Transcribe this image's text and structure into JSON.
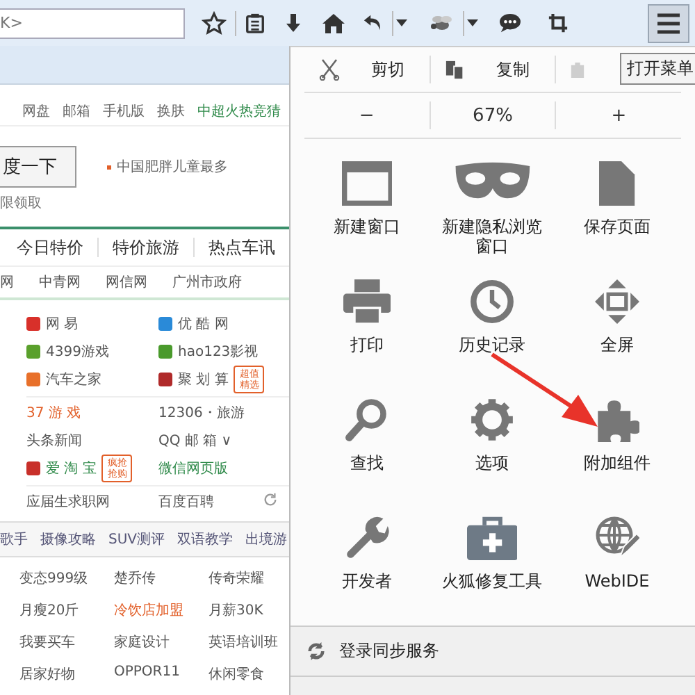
{
  "toolbar": {
    "url_fragment": "K>",
    "menu_open": true
  },
  "page": {
    "top_links": [
      {
        "label": "网盘",
        "color": "#666666"
      },
      {
        "label": "邮箱",
        "color": "#666666"
      },
      {
        "label": "手机版",
        "color": "#666666"
      },
      {
        "label": "换肤",
        "color": "#666666"
      },
      {
        "label": "中超火热竞猜",
        "color": "#2f8a4a"
      }
    ],
    "search_button": "度一下",
    "hot_search": "中国肥胖儿童最多",
    "hint": "限领取",
    "tabs": [
      "今日特价",
      "特价旅游",
      "热点车讯"
    ],
    "links": [
      "网",
      "中青网",
      "网信网",
      "广州市政府"
    ],
    "site_groups": [
      [
        {
          "label": "网 易",
          "kind": "logo",
          "color": "#555555"
        },
        {
          "label": "优 酷 网",
          "kind": "logo",
          "color": "#555555"
        },
        {
          "label": "4399游戏",
          "kind": "logo",
          "color": "#555555"
        },
        {
          "label": "hao123影视",
          "kind": "logo",
          "color": "#555555"
        },
        {
          "label": "汽车之家",
          "kind": "logo",
          "color": "#555555"
        },
        {
          "label": "聚 划 算",
          "kind": "logo",
          "color": "#555555",
          "badge": "超值精选"
        }
      ],
      [
        {
          "label": "37 游 戏",
          "kind": "plain",
          "color": "#e2602a"
        },
        {
          "label": "12306・旅游",
          "kind": "plain",
          "color": "#555555"
        },
        {
          "label": "头条新闻",
          "kind": "plain",
          "color": "#555555"
        },
        {
          "label": "QQ 邮 箱 ∨",
          "kind": "plain",
          "color": "#555555"
        },
        {
          "label": "爱 淘 宝",
          "kind": "logo",
          "color": "#2f8a4a",
          "badge": "疯抢抢购"
        },
        {
          "label": "微信网页版",
          "kind": "plain",
          "color": "#2f8a4a"
        }
      ],
      [
        {
          "label": "应届生求职网",
          "kind": "plain",
          "color": "#555555"
        },
        {
          "label": "百度百聘",
          "kind": "plain",
          "color": "#555555"
        }
      ]
    ],
    "news_tabs": [
      "歌手",
      "摄像攻略",
      "SUV测评",
      "双语教学",
      "出境游"
    ],
    "hot_links": [
      {
        "label": "变态999级",
        "color": "#555555"
      },
      {
        "label": "楚乔传",
        "color": "#555555"
      },
      {
        "label": "传奇荣耀",
        "color": "#555555"
      },
      {
        "label": "月瘦20斤",
        "color": "#555555"
      },
      {
        "label": "冷饮店加盟",
        "color": "#e2602a"
      },
      {
        "label": "月薪30K",
        "color": "#555555"
      },
      {
        "label": "我要买车",
        "color": "#555555"
      },
      {
        "label": "家庭设计",
        "color": "#555555"
      },
      {
        "label": "英语培训班",
        "color": "#555555"
      },
      {
        "label": "居家好物",
        "color": "#555555"
      },
      {
        "label": "OPPOR11",
        "color": "#555555"
      },
      {
        "label": "休闲零食",
        "color": "#555555"
      }
    ]
  },
  "menu": {
    "edit": [
      {
        "label": "剪切"
      },
      {
        "label": "复制"
      }
    ],
    "paste_disabled": true,
    "zoom": {
      "minus": "−",
      "level_text": "67%",
      "plus": "+"
    },
    "items": [
      "新建窗口",
      "新建隐私浏览窗口",
      "保存页面",
      "打印",
      "历史记录",
      "全屏",
      "查找",
      "选项",
      "附加组件",
      "开发者",
      "火狐修复工具",
      "WebIDE"
    ],
    "sync": "登录同步服务",
    "tooltip": "打开菜单"
  }
}
